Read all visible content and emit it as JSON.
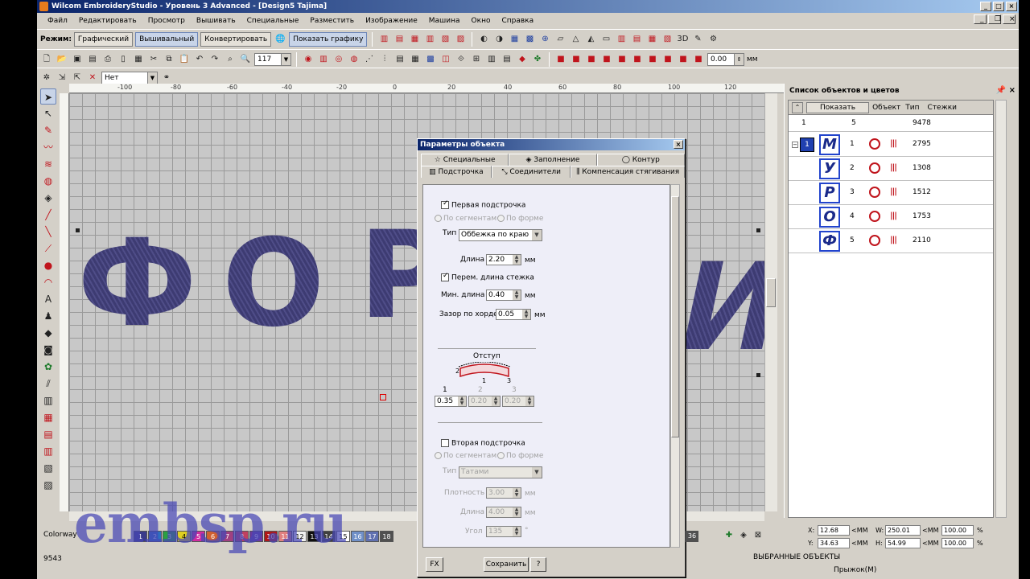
{
  "window": {
    "title": "Wilcom EmbroideryStudio - Уровень 3 Advanced - [Design5         Tajima]"
  },
  "menu": [
    "Файл",
    "Редактировать",
    "Просмотр",
    "Вышивать",
    "Специальные",
    "Разместить",
    "Изображение",
    "Машина",
    "Окно",
    "Справка"
  ],
  "toolbar": {
    "mode_label": "Режим:",
    "mode_graphic": "Графический",
    "mode_embroidery": "Вышивальный",
    "mode_convert": "Конвертировать",
    "show_graphics": "Показать графику",
    "zoom_value": "117",
    "none_value": "Нет",
    "offset_value": "0.00",
    "offset_unit": "мм"
  },
  "ruler": {
    "top_ticks": [
      "-100",
      "-80",
      "-60",
      "-40",
      "-20",
      "0",
      "20",
      "40",
      "60",
      "80",
      "100",
      "120"
    ]
  },
  "canvas": {
    "letters_visible": [
      "Ф",
      "О",
      "Р",
      "И"
    ]
  },
  "dialog": {
    "title": "Параметры объекта",
    "tabs_row1": [
      "Специальные",
      "Заполнение",
      "Контур"
    ],
    "tabs_row2": [
      "Подстрочка",
      "Соединители",
      "Компенсация стягивания"
    ],
    "first_underlay_label": "Первая подстрочка",
    "by_segments": "По сегментам",
    "by_shape": "По форме",
    "type_label": "Тип",
    "type_value": "Оббежка по краю",
    "length_label": "Длина",
    "length_value": "2.20",
    "unit_mm": "мм",
    "var_length_label": "Перем. длина стежка",
    "min_length_label": "Мин. длина",
    "min_length_value": "0.40",
    "chord_gap_label": "Зазор по хорде",
    "chord_gap_value": "0.05",
    "offset_label": "Отступ",
    "offset_idx1": "1",
    "offset_idx2": "2",
    "offset_idx3": "3",
    "offset_v1": "0.35",
    "offset_v2": "0.20",
    "offset_v3": "0.20",
    "second_underlay_label": "Вторая подстрочка",
    "type2_value": "Татами",
    "density_label": "Плотность",
    "density_value": "3.00",
    "length2_label": "Длина",
    "length2_value": "4.00",
    "angle_label": "Угол",
    "angle_value": "135",
    "angle_unit": "°",
    "btn_fx": "FX",
    "btn_save": "Сохранить",
    "btn_help": "?"
  },
  "objects_panel": {
    "title": "Список объектов и цветов",
    "show_button": "Показать",
    "col_obj": "Объект",
    "col_type": "Тип",
    "col_stitches": "Стежки",
    "summary": {
      "idx": "1",
      "count": "5",
      "stitches": "9478"
    },
    "group_number": "1",
    "rows": [
      {
        "letter": "М",
        "num": "1",
        "stitches": "2795"
      },
      {
        "letter": "У",
        "num": "2",
        "stitches": "1308"
      },
      {
        "letter": "Р",
        "num": "3",
        "stitches": "1512"
      },
      {
        "letter": "О",
        "num": "4",
        "stitches": "1753"
      },
      {
        "letter": "Ф",
        "num": "5",
        "stitches": "2110"
      }
    ]
  },
  "colorway": {
    "label": "Colorway",
    "swatches": [
      "1",
      "2",
      "3",
      "4",
      "5",
      "6",
      "7",
      "8",
      "9",
      "10",
      "11",
      "12",
      "13",
      "14",
      "15",
      "16",
      "17",
      "18"
    ],
    "right_number": "36"
  },
  "coords": {
    "x_label": "X:",
    "x_value": "12.68",
    "x_unit": "<MM",
    "y_label": "Y:",
    "y_value": "34.63",
    "y_unit": "<MM",
    "w_label": "W:",
    "w_value": "250.01",
    "w_unit": "<MM",
    "w_pct": "100.00",
    "w_pct_unit": "%",
    "h_label": "H:",
    "h_value": "54.99",
    "h_unit": "<MM",
    "h_pct": "100.00",
    "h_pct_unit": "%"
  },
  "status": {
    "stitch_count": "9543",
    "selected_objects": "ВЫБРАННЫЕ ОБЪЕКТЫ",
    "jump": "Прыжок(M)"
  },
  "watermark": "embsp.ru"
}
